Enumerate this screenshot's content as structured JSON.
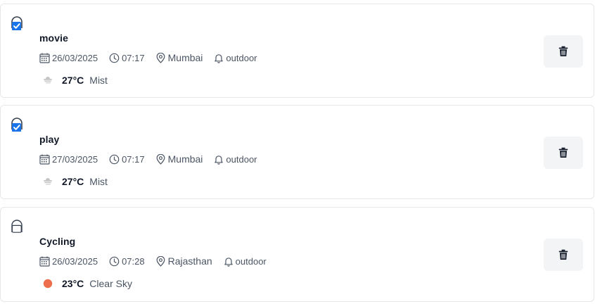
{
  "tasks": [
    {
      "title": "movie",
      "checked": true,
      "date": "26/03/2025",
      "time": "07:17",
      "location": "Mumbai",
      "category": "outdoor",
      "temperature": "27°C",
      "weather": "Mist",
      "weather_icon": "mist-icon"
    },
    {
      "title": "play",
      "checked": true,
      "date": "27/03/2025",
      "time": "07:17",
      "location": "Mumbai",
      "category": "outdoor",
      "temperature": "27°C",
      "weather": "Mist",
      "weather_icon": "mist-icon"
    },
    {
      "title": "Cycling",
      "checked": false,
      "date": "26/03/2025",
      "time": "07:28",
      "location": "Rajasthan",
      "category": "outdoor",
      "temperature": "23°C",
      "weather": "Clear Sky",
      "weather_icon": "sun-icon"
    }
  ],
  "icons": {
    "checkbox": "checkbox-icon",
    "calendar": "calendar-icon",
    "clock": "clock-icon",
    "location": "map-pin-icon",
    "category": "bell-icon",
    "delete": "trash-icon"
  },
  "colors": {
    "checkbox_checked": "#1a73e8",
    "clear_sky_sun": "#ec6e4c",
    "mist": "#b5b5b5",
    "delete_button_bg": "#f3f4f6",
    "card_border": "#e5e7eb"
  }
}
